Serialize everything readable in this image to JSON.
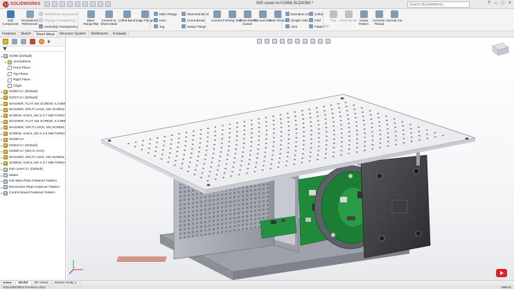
{
  "app": {
    "logo_text": "SOLIDWORKS",
    "document_title": "INS cover-in-01066.SLDASM *",
    "search_placeholder": "Search MySolidWorks",
    "window_controls": [
      "?",
      "–",
      "□",
      "×"
    ]
  },
  "ribbon": {
    "large": [
      {
        "label": "Edit Component",
        "icon": "edit-component-icon",
        "color": "#3c78b5"
      },
      {
        "label": "No External References",
        "icon": "external-references-icon",
        "color": "#8aa0b8"
      },
      {
        "label": "Base Flange/Tab",
        "icon": "base-flange-icon",
        "color": "#7e9bb8"
      },
      {
        "label": "Convert to Sheet Metal",
        "icon": "convert-sheet-metal-icon",
        "color": "#7e9bb8"
      },
      {
        "label": "Lofted-Bend",
        "icon": "lofted-bend-icon",
        "color": "#7e9bb8"
      },
      {
        "label": "Edge Flange",
        "icon": "edge-flange-icon",
        "color": "#7e9bb8"
      },
      {
        "label": "Corners",
        "icon": "corners-icon",
        "color": "#7e9bb8"
      },
      {
        "label": "Forming Tool",
        "icon": "forming-tool-icon",
        "color": "#7e9bb8"
      },
      {
        "label": "Sheet Metal Gusset",
        "icon": "gusset-icon",
        "color": "#7e9bb8"
      },
      {
        "label": "Tab and Slot",
        "icon": "tab-slot-icon",
        "color": "#7e9bb8"
      },
      {
        "label": "Hole Wizard",
        "icon": "hole-wizard-icon",
        "color": "#7e9bb8"
      },
      {
        "label": "Flat",
        "icon": "flat-icon",
        "color": "#c0c0c0"
      },
      {
        "label": "Insert Bends",
        "icon": "insert-bends-icon",
        "color": "#c0c0c0"
      },
      {
        "label": "Linear Pattern",
        "icon": "linear-pattern-icon",
        "color": "#7e9bb8"
      },
      {
        "label": "Cosmetic Thread",
        "icon": "cosmetic-thread-icon",
        "color": "#7e9bb8"
      },
      {
        "label": "Normal Cut",
        "icon": "normal-cut-icon",
        "color": "#7e9bb8"
      }
    ],
    "small_col1": [
      {
        "label": "Hide/Show Components",
        "icon": "hide-show-icon",
        "disabled": true
      },
      {
        "label": "Change Transparency",
        "icon": "transparency-icon",
        "disabled": true
      },
      {
        "label": "Assembly Transparency",
        "icon": "assembly-transparency-icon",
        "disabled": false
      }
    ],
    "small_col2": [
      {
        "label": "Miter Flange",
        "icon": "miter-flange-icon"
      },
      {
        "label": "Hem",
        "icon": "hem-icon"
      },
      {
        "label": "Jog",
        "icon": "jog-icon"
      }
    ],
    "small_col3": [
      {
        "label": "Sketched Bend",
        "icon": "sketched-bend-icon"
      },
      {
        "label": "Cross-Break",
        "icon": "cross-break-icon"
      },
      {
        "label": "Swept Flange",
        "icon": "swept-flange-icon"
      }
    ],
    "small_col4": [
      {
        "label": "Extruded Cut",
        "icon": "extruded-cut-icon"
      },
      {
        "label": "Simple Hole",
        "icon": "simple-hole-icon"
      },
      {
        "label": "Vent",
        "icon": "vent-icon"
      }
    ],
    "small_col5": [
      {
        "label": "Unfold",
        "icon": "unfold-icon"
      },
      {
        "label": "Fold",
        "icon": "fold-icon"
      },
      {
        "label": "Flatten",
        "icon": "flatten-icon"
      }
    ],
    "rip_label": "Rip"
  },
  "tabs": [
    "Features",
    "Sketch",
    "Sheet Metal",
    "Structure System",
    "Weldments",
    "Evaluate"
  ],
  "active_tab": "Sheet Metal",
  "tree": {
    "root": "01066 (Default)",
    "items": [
      {
        "label": "Annotations",
        "icon": "folder",
        "exp": "▸",
        "indent": 1
      },
      {
        "label": "Front Plane",
        "icon": "plane",
        "exp": "",
        "indent": 1
      },
      {
        "label": "Top Plane",
        "icon": "plane",
        "exp": "",
        "indent": 1
      },
      {
        "label": "Right Plane",
        "icon": "plane",
        "exp": "",
        "indent": 1
      },
      {
        "label": "Origin",
        "icon": "origin",
        "exp": "",
        "indent": 1
      },
      {
        "label": "01063<1> (Default)",
        "icon": "part",
        "exp": "▸",
        "indent": 0
      },
      {
        "label": "01027<1> (Default)",
        "icon": "part",
        "exp": "▸",
        "indent": 0
      },
      {
        "label": "WASHER, FLAT, M4 SCREW, 4.3 MM I",
        "icon": "part",
        "exp": "▸",
        "indent": 0
      },
      {
        "label": "WASHER, SPLIT LOCK, M4 SCREW, 4",
        "icon": "part",
        "exp": "▸",
        "indent": 0
      },
      {
        "label": "SCREW, SHCS, M4 X 0.7 MM THREA",
        "icon": "part",
        "exp": "▸",
        "indent": 0
      },
      {
        "label": "WASHER, FLAT, M4 SCREW, 4.3 MM",
        "icon": "part",
        "exp": "▸",
        "indent": 0
      },
      {
        "label": "WASHER, SPLIT LOCK, M4 SCREW, 4",
        "icon": "part",
        "exp": "▸",
        "indent": 0
      },
      {
        "label": "SCREW, SHCS, M3 X 0.5 MM THREA",
        "icon": "part",
        "exp": "▸",
        "indent": 0
      },
      {
        "label": "01038<1>",
        "icon": "part",
        "exp": "▸",
        "indent": 0
      },
      {
        "label": "01564<1> (Default)",
        "icon": "part",
        "exp": "▸",
        "indent": 0
      },
      {
        "label": "01065<1> (INS to VCH)",
        "icon": "part",
        "exp": "▸",
        "indent": 0
      },
      {
        "label": "WASHER, SPLIT LOCK, M3 SCREW, 3.",
        "icon": "part",
        "exp": "▸",
        "indent": 0
      },
      {
        "label": "SCREW, SHCS, M4 X 0.7 MM THREA",
        "icon": "part",
        "exp": "▸",
        "indent": 0
      },
      {
        "label": "INS cover<1> (Default)",
        "icon": "asm",
        "exp": "▸",
        "indent": 0
      },
      {
        "label": "Mates",
        "icon": "mates",
        "exp": "▸",
        "indent": 0
      },
      {
        "label": "INS Main Plate Fastener Pattern",
        "icon": "pattern",
        "exp": "▸",
        "indent": 0
      },
      {
        "label": "Electronics Plate Fastener Pattern",
        "icon": "pattern",
        "exp": "▸",
        "indent": 0
      },
      {
        "label": "Control Board Fastener Pattern",
        "icon": "pattern",
        "exp": "▸",
        "indent": 0
      }
    ]
  },
  "bottom_tabs": [
    "Model",
    "3D Views",
    "Motion Study 1"
  ],
  "active_bottom_tab": "Model",
  "status": {
    "left": "SOLIDWORKS Premium 2021",
    "right": "MMGS"
  },
  "colors": {
    "accent_red": "#d3252a",
    "plate": "#f2f2f2",
    "frame_metal": "#a9acb4",
    "pcb_green": "#1e8a3a",
    "dark_plate": "#3b3b3e"
  }
}
